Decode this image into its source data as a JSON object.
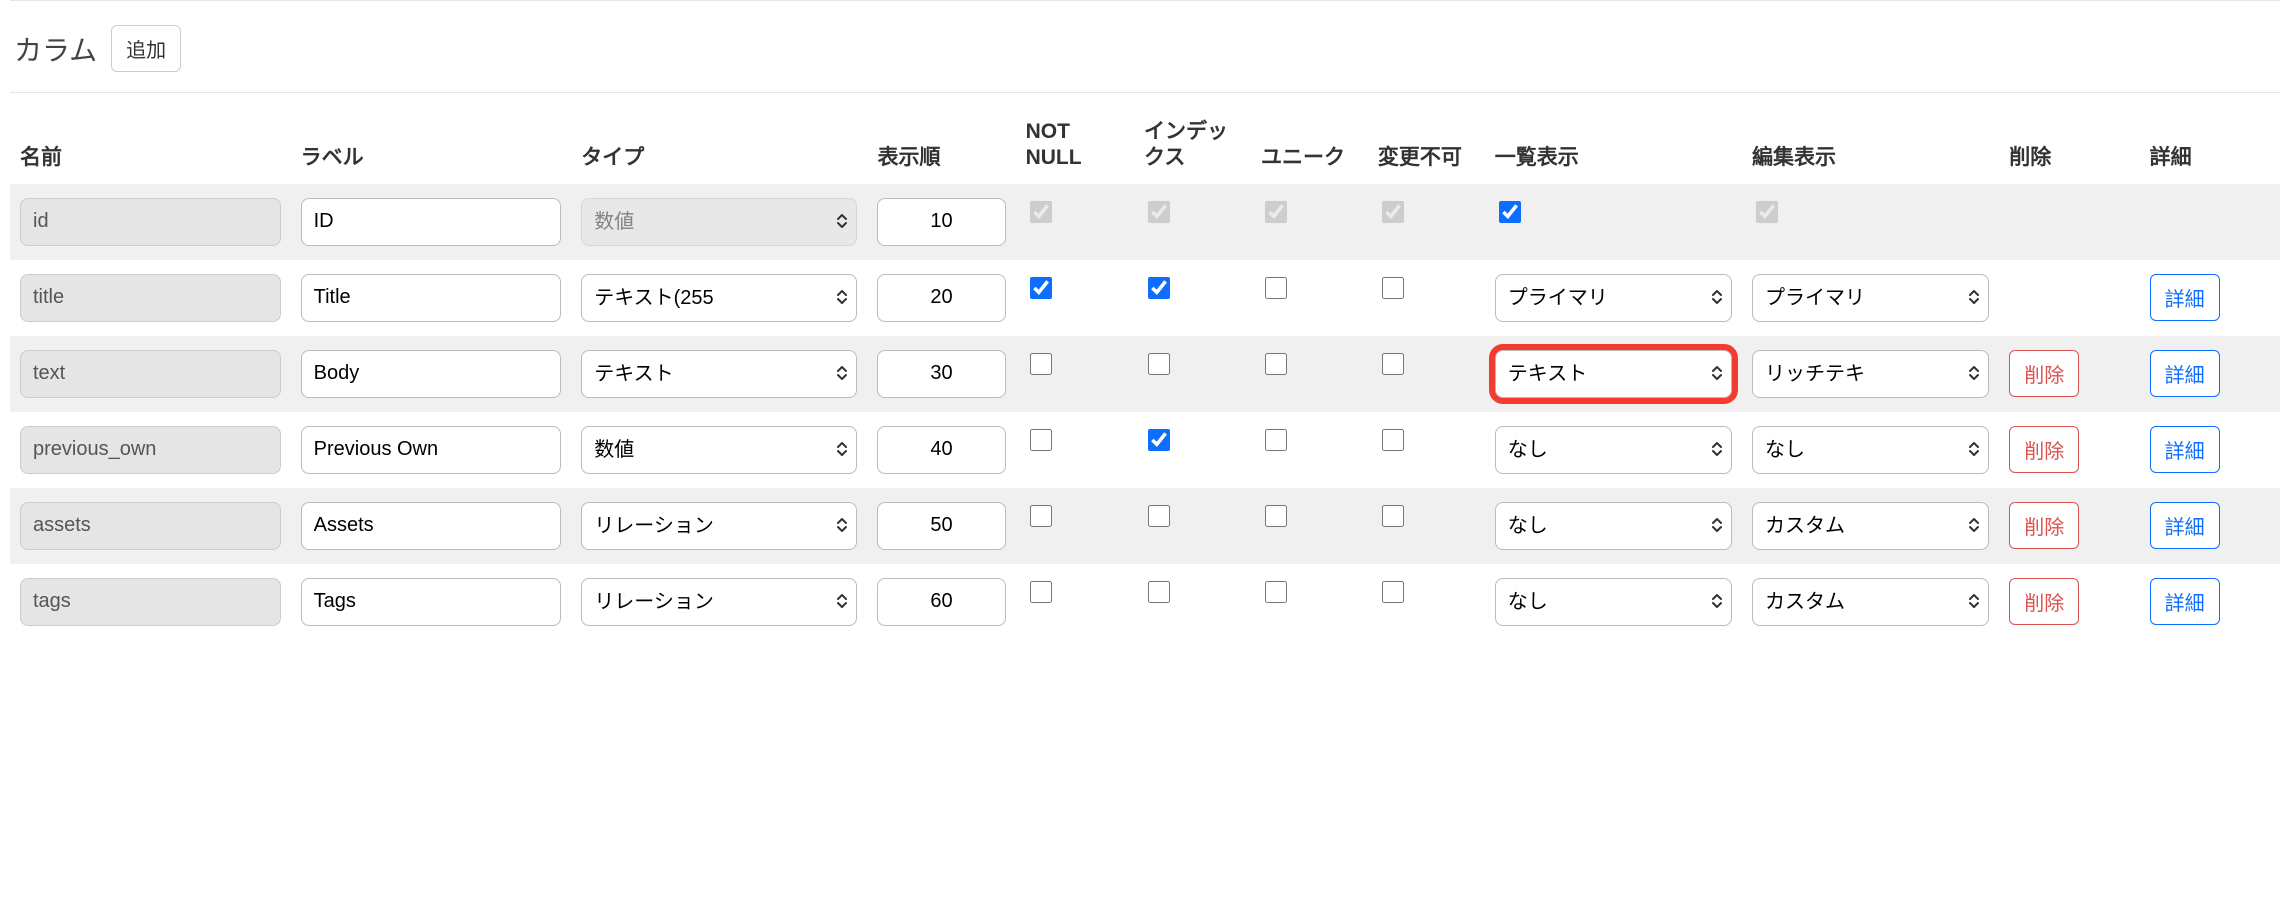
{
  "section": {
    "title": "カラム",
    "add_button": "追加"
  },
  "headers": {
    "name": "名前",
    "label": "ラベル",
    "type": "タイプ",
    "order": "表示順",
    "not_null": "NOT NULL",
    "index": "インデックス",
    "unique": "ユニーク",
    "immutable": "変更不可",
    "list_display": "一覧表示",
    "edit_display": "編集表示",
    "delete": "削除",
    "detail": "詳細"
  },
  "buttons": {
    "delete": "削除",
    "detail": "詳細"
  },
  "rows": [
    {
      "name": "id",
      "label": "ID",
      "type": "数値",
      "order": "10",
      "not_null": true,
      "index": true,
      "unique": true,
      "immutable": true,
      "list_checkbox": true,
      "edit_checkbox_disabled": true,
      "name_disabled": true,
      "type_disabled": true,
      "ck_disabled": true,
      "list_select": null,
      "edit_select": null,
      "delete": false,
      "detail": false,
      "alt": true
    },
    {
      "name": "title",
      "label": "Title",
      "type": "テキスト(255",
      "order": "20",
      "not_null": true,
      "index": true,
      "unique": false,
      "immutable": false,
      "name_disabled": true,
      "list_select": "プライマリ",
      "edit_select": "プライマリ",
      "delete": false,
      "detail": true,
      "alt": false
    },
    {
      "name": "text",
      "label": "Body",
      "type": "テキスト",
      "order": "30",
      "not_null": false,
      "index": false,
      "unique": false,
      "immutable": false,
      "name_disabled": true,
      "list_select": "テキスト",
      "edit_select": "リッチテキ",
      "list_highlight": true,
      "delete": true,
      "detail": true,
      "alt": true
    },
    {
      "name": "previous_own",
      "label": "Previous Own",
      "type": "数値",
      "order": "40",
      "not_null": false,
      "index": true,
      "unique": false,
      "immutable": false,
      "name_disabled": true,
      "list_select": "なし",
      "edit_select": "なし",
      "delete": true,
      "detail": true,
      "alt": false
    },
    {
      "name": "assets",
      "label": "Assets",
      "type": "リレーション",
      "order": "50",
      "not_null": false,
      "index": false,
      "unique": false,
      "immutable": false,
      "name_disabled": true,
      "list_select": "なし",
      "edit_select": "カスタム",
      "delete": true,
      "detail": true,
      "alt": true
    },
    {
      "name": "tags",
      "label": "Tags",
      "type": "リレーション",
      "order": "60",
      "not_null": false,
      "index": false,
      "unique": false,
      "immutable": false,
      "name_disabled": true,
      "list_select": "なし",
      "edit_select": "カスタム",
      "delete": true,
      "detail": true,
      "alt": false
    }
  ]
}
